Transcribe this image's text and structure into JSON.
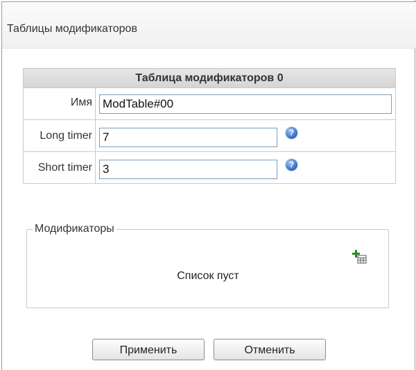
{
  "header": {
    "title": "Таблицы модификаторов"
  },
  "table": {
    "title": "Таблица модификаторов 0",
    "rows": [
      {
        "label": "Имя",
        "value": "ModTable#00"
      },
      {
        "label": "Long timer",
        "value": "7"
      },
      {
        "label": "Short timer",
        "value": "3"
      }
    ]
  },
  "modifiers": {
    "legend": "Модификаторы",
    "empty_text": "Список пуст"
  },
  "buttons": {
    "apply": "Применить",
    "cancel": "Отменить"
  },
  "colors": {
    "help_icon": "#2f6ac8",
    "add_icon": "#2a8a2a",
    "header_bg": "#f3f3f3"
  },
  "icons": {
    "help": "question-circle-icon",
    "add": "add-row-icon"
  }
}
